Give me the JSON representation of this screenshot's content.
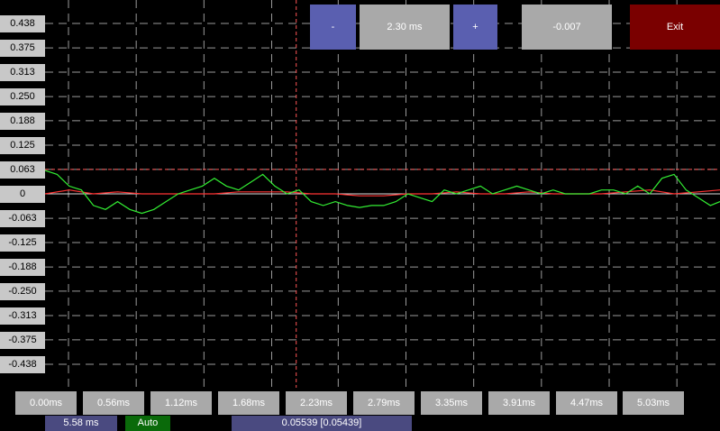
{
  "y_labels": [
    "0.438",
    "0.375",
    "0.313",
    "0.250",
    "0.188",
    "0.125",
    "0.063",
    "0",
    "-0.063",
    "-0.125",
    "-0.188",
    "-0.250",
    "-0.313",
    "-0.375",
    "-0.438"
  ],
  "x_labels": [
    "0.00ms",
    "0.56ms",
    "1.12ms",
    "1.68ms",
    "2.23ms",
    "2.79ms",
    "3.35ms",
    "3.91ms",
    "4.47ms",
    "5.03ms"
  ],
  "toolbar": {
    "minus_label": "-",
    "timebase_label": "2.30 ms",
    "plus_label": "+",
    "offset_label": "-0.007",
    "exit_label": "Exit"
  },
  "status": {
    "span_label": "5.58 ms",
    "mode_label": "Auto",
    "cursor_readout": "0.05539 [0.05439]"
  },
  "colors": {
    "grid": "#9a9a9a",
    "channel_green": "#33ee33",
    "channel_red": "#ff3333",
    "trigger_line": "#ff5555",
    "minus_plus_button": "#5a5fb0",
    "value_button": "#a9a9a9",
    "exit_button": "#7a0000",
    "span_bg": "#4a4a80",
    "mode_bg": "#0a6a0a",
    "readout_bg": "#4a4a80"
  },
  "chart_data": {
    "type": "line",
    "x_unit": "ms",
    "ylim": [
      -0.438,
      0.438
    ],
    "xlim": [
      0,
      5.58
    ],
    "grid": true,
    "trigger_level": 0.063,
    "trigger_time_ms": 2.3,
    "series": [
      {
        "color": "green",
        "x": [
          0,
          0.1,
          0.2,
          0.3,
          0.4,
          0.5,
          0.6,
          0.7,
          0.8,
          0.9,
          1.0,
          1.1,
          1.2,
          1.3,
          1.4,
          1.5,
          1.6,
          1.7,
          1.8,
          1.9,
          2.0,
          2.1,
          2.2,
          2.3,
          2.4,
          2.5,
          2.6,
          2.7,
          2.8,
          2.9,
          3.0,
          3.1,
          3.2,
          3.3,
          3.4,
          3.5,
          3.6,
          3.7,
          3.8,
          3.9,
          4.0,
          4.1,
          4.2,
          4.3,
          4.4,
          4.5,
          4.6,
          4.7,
          4.8,
          4.9,
          5.0,
          5.1,
          5.2,
          5.3,
          5.4,
          5.5,
          5.58
        ],
        "values": [
          0.06,
          0.05,
          0.02,
          0.01,
          -0.03,
          -0.04,
          -0.02,
          -0.04,
          -0.05,
          -0.04,
          -0.02,
          0.0,
          0.01,
          0.02,
          0.04,
          0.02,
          0.01,
          0.03,
          0.05,
          0.02,
          0.0,
          0.01,
          -0.02,
          -0.03,
          -0.02,
          -0.03,
          -0.035,
          -0.03,
          -0.03,
          -0.02,
          0.0,
          -0.01,
          -0.02,
          0.01,
          0.0,
          0.01,
          0.02,
          0.0,
          0.01,
          0.02,
          0.01,
          0.0,
          0.01,
          0.0,
          0.0,
          0.0,
          0.01,
          0.01,
          0.0,
          0.02,
          0.0,
          0.04,
          0.05,
          0.01,
          -0.01,
          -0.03,
          -0.02
        ]
      },
      {
        "color": "red",
        "x": [
          0,
          0.2,
          0.4,
          0.6,
          0.8,
          1.0,
          1.2,
          1.4,
          1.6,
          1.8,
          2.0,
          2.2,
          2.4,
          2.6,
          2.8,
          3.0,
          3.2,
          3.4,
          3.6,
          3.8,
          4.0,
          4.2,
          4.4,
          4.6,
          4.8,
          5.0,
          5.2,
          5.4,
          5.58
        ],
        "values": [
          0.0,
          0.01,
          0.0,
          0.005,
          0.0,
          0.0,
          0.0,
          0.0,
          0.005,
          0.005,
          0.005,
          0.0,
          0.0,
          -0.005,
          -0.005,
          0.0,
          0.0,
          0.005,
          0.0,
          0.0,
          0.005,
          0.0,
          0.0,
          0.0,
          0.005,
          0.01,
          0.0,
          0.005,
          0.01
        ]
      }
    ]
  }
}
